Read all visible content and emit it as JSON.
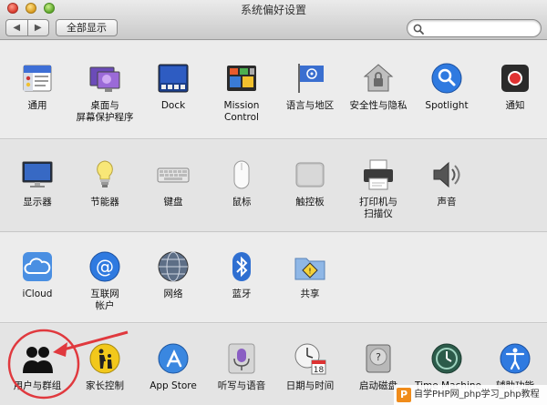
{
  "window": {
    "title": "系统偏好设置"
  },
  "toolbar": {
    "back": "◀",
    "forward": "▶",
    "show_all": "全部显示"
  },
  "rows": [
    [
      {
        "id": "general",
        "label": "通用",
        "icon": "general-icon"
      },
      {
        "id": "desktop",
        "label": "桌面与\n屏幕保护程序",
        "icon": "desktop-screensaver-icon"
      },
      {
        "id": "dock",
        "label": "Dock",
        "icon": "dock-icon"
      },
      {
        "id": "mission",
        "label": "Mission\nControl",
        "icon": "mission-control-icon"
      },
      {
        "id": "language",
        "label": "语言与地区",
        "icon": "flag-icon"
      },
      {
        "id": "security",
        "label": "安全性与隐私",
        "icon": "house-lock-icon"
      },
      {
        "id": "spotlight",
        "label": "Spotlight",
        "icon": "magnifier-icon"
      },
      {
        "id": "notifications",
        "label": "通知",
        "icon": "notifications-icon"
      }
    ],
    [
      {
        "id": "displays",
        "label": "显示器",
        "icon": "monitor-icon"
      },
      {
        "id": "energy",
        "label": "节能器",
        "icon": "lightbulb-icon"
      },
      {
        "id": "keyboard",
        "label": "键盘",
        "icon": "keyboard-icon"
      },
      {
        "id": "mouse",
        "label": "鼠标",
        "icon": "mouse-icon"
      },
      {
        "id": "trackpad",
        "label": "触控板",
        "icon": "trackpad-icon"
      },
      {
        "id": "printers",
        "label": "打印机与\n扫描仪",
        "icon": "printer-icon"
      },
      {
        "id": "sound",
        "label": "声音",
        "icon": "speaker-icon"
      }
    ],
    [
      {
        "id": "icloud",
        "label": "iCloud",
        "icon": "cloud-icon"
      },
      {
        "id": "internet",
        "label": "互联网\n帐户",
        "icon": "at-sign-icon"
      },
      {
        "id": "network",
        "label": "网络",
        "icon": "globe-icon"
      },
      {
        "id": "bluetooth",
        "label": "蓝牙",
        "icon": "bluetooth-icon"
      },
      {
        "id": "sharing",
        "label": "共享",
        "icon": "sharing-folder-icon"
      }
    ],
    [
      {
        "id": "users",
        "label": "用户与群组",
        "icon": "users-icon"
      },
      {
        "id": "parental",
        "label": "家长控制",
        "icon": "parental-controls-icon"
      },
      {
        "id": "appstore",
        "label": "App Store",
        "icon": "app-store-icon"
      },
      {
        "id": "dictation",
        "label": "听写与语音",
        "icon": "microphone-icon"
      },
      {
        "id": "datetime",
        "label": "日期与时间",
        "icon": "clock-calendar-icon"
      },
      {
        "id": "startup",
        "label": "启动磁盘",
        "icon": "hard-disk-icon"
      },
      {
        "id": "timemachine",
        "label": "Time Machine",
        "icon": "time-machine-icon"
      },
      {
        "id": "accessibility",
        "label": "辅助功能",
        "icon": "accessibility-icon"
      }
    ]
  ],
  "calendar_day": "18",
  "watermark": {
    "logo": "P",
    "text": "自学PHP网_php学习_php教程"
  }
}
